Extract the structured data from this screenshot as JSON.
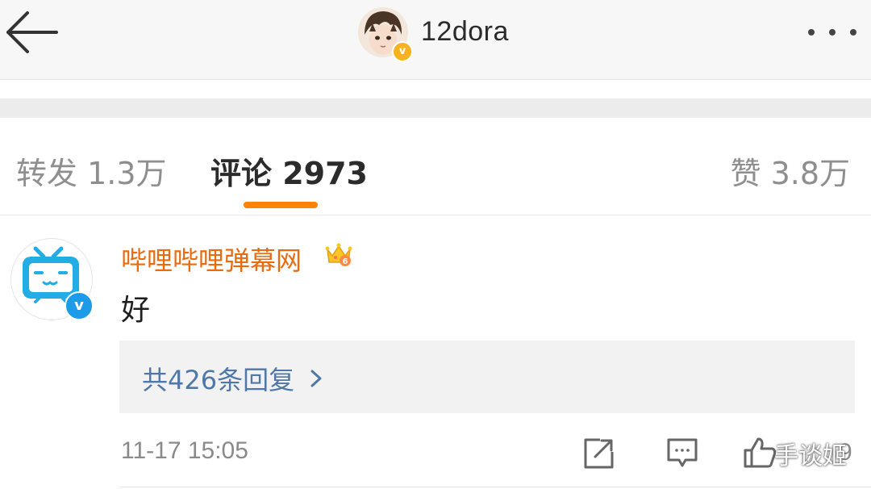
{
  "header": {
    "username": "12dora",
    "verified_mark": "v",
    "back_icon": "back-arrow-icon",
    "more_icon": "more-dots-icon"
  },
  "tabs": [
    {
      "label": "转发 1.3万",
      "active": false
    },
    {
      "label": "评论 2973",
      "active": true
    },
    {
      "label": "赞 3.8万",
      "active": false
    }
  ],
  "comment": {
    "author": "哔哩哔哩弹幕网",
    "author_badge_icon": "crown-icon",
    "author_badge_level": "6",
    "verified_mark": "v",
    "text": "好",
    "replies_label": "共426条回复",
    "timestamp": "11-17 15:05",
    "like_count": "9",
    "actions": [
      "share-icon",
      "reply-icon",
      "like-icon"
    ]
  },
  "watermark": "手谈姬",
  "colors": {
    "accent": "#ff8200",
    "author_name": "#e86b10",
    "link": "#4f77a8",
    "verified_blue": "#1d9be9",
    "verified_gold": "#f8b21c"
  }
}
